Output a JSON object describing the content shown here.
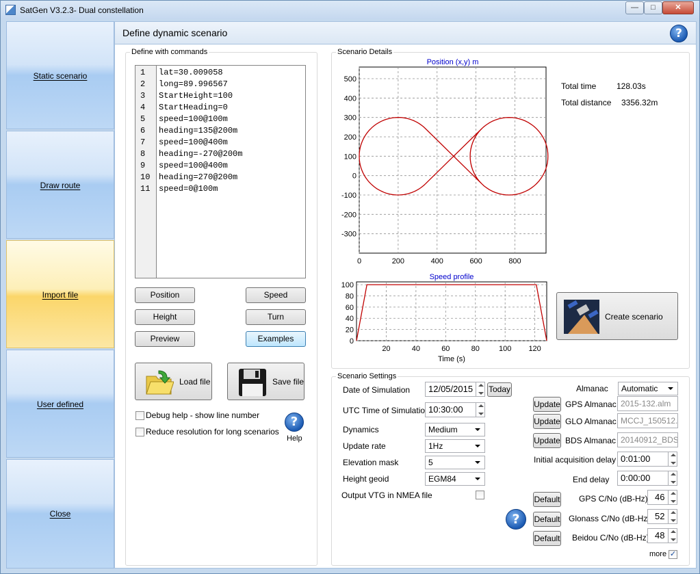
{
  "window": {
    "title": "SatGen V3.2.3- Dual constellation",
    "min": "—",
    "max": "□",
    "close": "✕"
  },
  "sidebar": {
    "items": [
      {
        "label": "Static scenario"
      },
      {
        "label": "Draw route"
      },
      {
        "label": "Import file"
      },
      {
        "label": "User defined"
      },
      {
        "label": "Close"
      }
    ],
    "active": "Import file"
  },
  "header": {
    "title": "Define dynamic scenario"
  },
  "commands": {
    "group_label": "Define with commands",
    "lines": [
      {
        "n": "1",
        "code": "lat=30.009058"
      },
      {
        "n": "2",
        "code": "long=89.996567"
      },
      {
        "n": "3",
        "code": "StartHeight=100"
      },
      {
        "n": "4",
        "code": "StartHeading=0"
      },
      {
        "n": "5",
        "code": "speed=100@100m"
      },
      {
        "n": "6",
        "code": "heading=135@200m"
      },
      {
        "n": "7",
        "code": "speed=100@400m"
      },
      {
        "n": "8",
        "code": "heading=-270@200m"
      },
      {
        "n": "9",
        "code": "speed=100@400m"
      },
      {
        "n": "10",
        "code": "heading=270@200m"
      },
      {
        "n": "11",
        "code": "speed=0@100m"
      }
    ],
    "buttons": {
      "position": "Position",
      "speed": "Speed",
      "height": "Height",
      "turn": "Turn",
      "preview": "Preview",
      "examples": "Examples",
      "load": "Load file",
      "save": "Save file"
    },
    "debug_label": "Debug help - show line number",
    "reduce_label": "Reduce resolution for long scenarios",
    "help_label": "Help"
  },
  "details": {
    "group_label": "Scenario Details",
    "total_time_label": "Total time",
    "total_time": "128.03s",
    "total_distance_label": "Total distance",
    "total_distance": "3356.32m",
    "create_label": "Create scenario"
  },
  "settings": {
    "group_label": "Scenario Settings",
    "date_label": "Date of Simulation",
    "date": "12/05/2015",
    "today": "Today",
    "utc_label": "UTC Time of Simulation",
    "utc": "10:30:00",
    "dynamics_label": "Dynamics",
    "dynamics": "Medium",
    "update_label": "Update rate",
    "update": "1Hz",
    "elev_label": "Elevation mask",
    "elev": "5",
    "geoid_label": "Height geoid",
    "geoid": "EGM84",
    "vtg_label": "Output VTG in NMEA file",
    "almanac_label": "Almanac",
    "almanac": "Automatic",
    "update_btn": "Update",
    "gps_alm_label": "GPS Almanac",
    "gps_alm": "2015-132.alm",
    "glo_alm_label": "GLO Almanac",
    "glo_alm": "MCCJ_150512.ag",
    "bds_alm_label": "BDS Almanac",
    "bds_alm": "20140912_BDS.a",
    "init_delay_label": "Initial acquisition delay",
    "init_delay": "0:01:00",
    "end_delay_label": "End delay",
    "end_delay": "0:00:00",
    "default_btn": "Default",
    "gps_cno_label": "GPS C/No (dB-Hz)",
    "gps_cno": "46",
    "glo_cno_label": "Glonass C/No (dB-Hz)",
    "glo_cno": "52",
    "bds_cno_label": "Beidou C/No (dB-Hz)",
    "bds_cno": "48",
    "more_label": "more"
  },
  "colors": {
    "trace": "#c00000",
    "chart_title": "#0000cc",
    "grid": "#909090"
  },
  "chart_data": [
    {
      "type": "line",
      "title": "Position (x,y) m",
      "xlabel": "",
      "ylabel": "",
      "xlim": [
        0,
        960
      ],
      "ylim": [
        -400,
        560
      ],
      "xticks": [
        0,
        200,
        400,
        600,
        800
      ],
      "yticks": [
        -300,
        -200,
        -100,
        0,
        100,
        200,
        300,
        400,
        500
      ],
      "series": [
        {
          "shape": "figure-eight",
          "circles": [
            {
              "cx": 200,
              "cy": 100,
              "r": 200
            },
            {
              "cx": 770,
              "cy": 100,
              "r": 200
            }
          ],
          "cross_point": [
            485,
            100
          ]
        }
      ],
      "grid": true
    },
    {
      "type": "line",
      "title": "Speed profile",
      "xlabel": "Time (s)",
      "ylabel": "",
      "xlim": [
        0,
        128
      ],
      "ylim": [
        0,
        105
      ],
      "xticks": [
        20,
        40,
        60,
        80,
        100,
        120
      ],
      "yticks": [
        0,
        20,
        40,
        60,
        80,
        100
      ],
      "series": [
        {
          "x": [
            0,
            7,
            121,
            128
          ],
          "y": [
            0,
            100,
            100,
            0
          ]
        }
      ],
      "grid": true
    }
  ]
}
